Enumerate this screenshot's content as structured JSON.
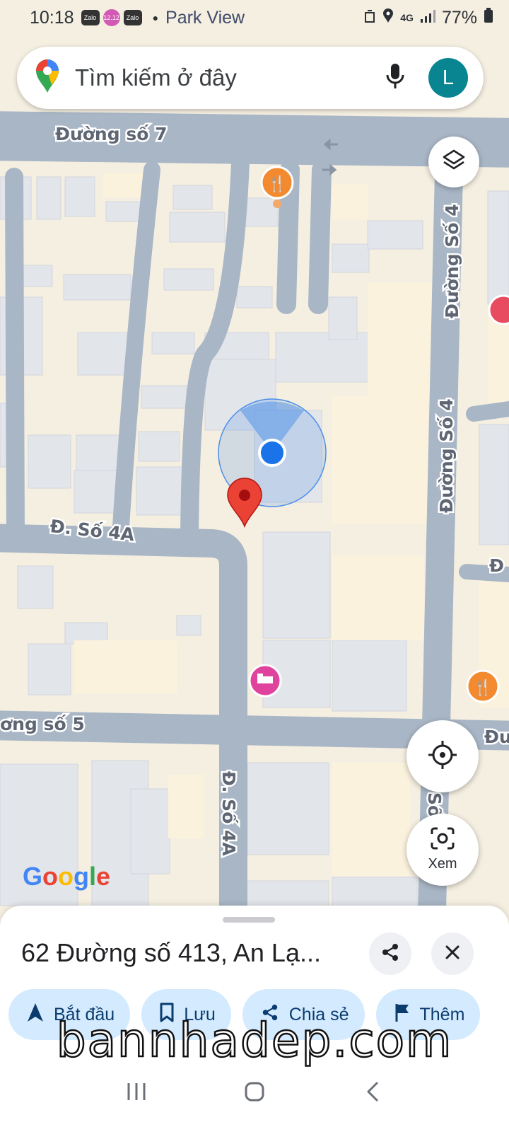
{
  "status_bar": {
    "time": "10:18",
    "notification_apps": [
      "Zalo",
      "12.12",
      "Zalo"
    ],
    "place": "Park View",
    "network": "4G",
    "battery": "77%"
  },
  "search": {
    "placeholder": "Tìm kiếm ở đây",
    "avatar_letter": "L"
  },
  "map": {
    "labels": {
      "street_7": "Đường số 7",
      "street_4_top": "Đường Số 4",
      "street_4_mid": "Đường Số 4",
      "street_4a_horizontal": "Đ. Số 4A",
      "street_5": "ơng số 5",
      "street_4a_vertical": "Đ. Số 4A",
      "street_edge_1": "Đ",
      "street_edge_2": "Đu",
      "street_edge_3": "Số"
    },
    "pois": [
      {
        "type": "restaurant",
        "color": "#f38a2f"
      },
      {
        "type": "hotel",
        "color": "#e0439e"
      },
      {
        "type": "restaurant",
        "color": "#f38a2f"
      }
    ],
    "accent_color": "#1a73e8",
    "pin_color": "#ea4335"
  },
  "controls": {
    "view_label": "Xem",
    "layers_icon": "layers-icon",
    "locate_icon": "my-location-icon"
  },
  "attribution": "Google",
  "place_sheet": {
    "title": "62 Đường số 413, An Lạ...",
    "actions": [
      {
        "label": "Bắt đầu",
        "icon": "navigation-arrow-icon"
      },
      {
        "label": "Lưu",
        "icon": "bookmark-icon"
      },
      {
        "label": "Chia sẻ",
        "icon": "share-icon"
      },
      {
        "label": "Thêm",
        "icon": "flag-icon"
      }
    ]
  },
  "watermark": "bannhadep.com"
}
